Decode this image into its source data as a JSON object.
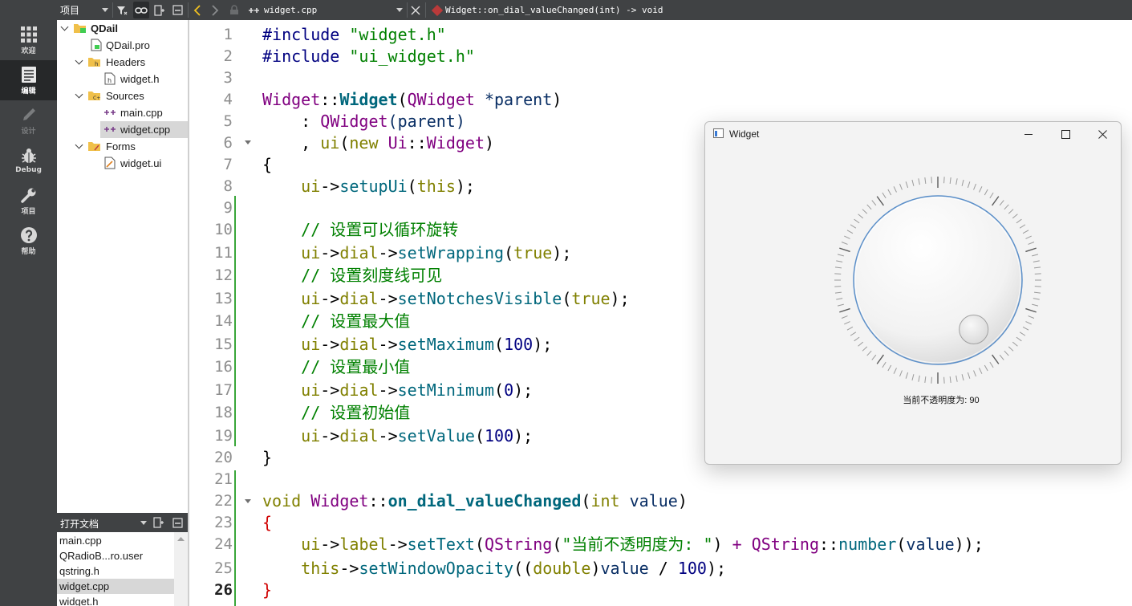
{
  "toolbar": {
    "project_selector": "项目",
    "file_tab": "widget.cpp",
    "function_path": "Widget::on_dial_valueChanged(int) -> void"
  },
  "modes": [
    {
      "label": "欢迎",
      "icon": "grid-icon"
    },
    {
      "label": "编辑",
      "icon": "document-icon"
    },
    {
      "label": "设计",
      "icon": "pencil-icon"
    },
    {
      "label": "Debug",
      "icon": "bug-icon"
    },
    {
      "label": "项目",
      "icon": "wrench-icon"
    },
    {
      "label": "帮助",
      "icon": "help-icon"
    }
  ],
  "tree": {
    "project": "QDail",
    "pro_file": "QDail.pro",
    "headers": "Headers",
    "header_file": "widget.h",
    "sources": "Sources",
    "source_main": "main.cpp",
    "source_widget": "widget.cpp",
    "forms": "Forms",
    "form_file": "widget.ui"
  },
  "open_documents": {
    "title": "打开文档",
    "items": [
      "main.cpp",
      "QRadioB...ro.user",
      "qstring.h",
      "widget.cpp",
      "widget.h"
    ]
  },
  "editor": {
    "line_numbers": [
      "1",
      "2",
      "3",
      "4",
      "5",
      "6",
      "7",
      "8",
      "9",
      "10",
      "11",
      "12",
      "13",
      "14",
      "15",
      "16",
      "17",
      "18",
      "19",
      "20",
      "21",
      "22",
      "23",
      "24",
      "25",
      "26"
    ],
    "current_line": "26",
    "code": {
      "inc": "#include",
      "inc1_file": "\"widget.h\"",
      "inc2_file": "\"ui_widget.h\"",
      "l4_class": "Widget",
      "l4_scope": "::",
      "l4_ctor": "Widget",
      "l4_open": "(",
      "l4_type": "QWidget",
      "l4_param": " *parent",
      "l4_close": ")",
      "l5_pre": "    : ",
      "l5_type": "QWidget",
      "l5_arg": "(parent)",
      "l6_pre": "    , ",
      "l6_ui": "ui",
      "l6_open": "(",
      "l6_new": "new",
      "l6_ns": "Ui",
      "l6_scope": "::",
      "l6_cls": "Widget",
      "l6_close": ")",
      "brace_open": "{",
      "brace_close": "}",
      "indent": "    ",
      "ui": "ui",
      "arrow": "->",
      "dial": "dial",
      "label": "label",
      "this": "this",
      "setupUi": "setupUi",
      "l8_args": "(",
      "l8_end": ");",
      "c10": "// 设置可以循环旋转",
      "setWrapping": "setWrapping",
      "true": "true",
      "c12": "// 设置刻度线可见",
      "setNotchesVisible": "setNotchesVisible",
      "c14": "// 设置最大值",
      "setMaximum": "setMaximum",
      "n100": "100",
      "c16": "// 设置最小值",
      "setMinimum": "setMinimum",
      "n0": "0",
      "c18": "// 设置初始值",
      "setValue": "setValue",
      "paren_open": "(",
      "end_paren": ");",
      "void": "void",
      "cls": "Widget",
      "scope": "::",
      "slot": "on_dial_valueChanged",
      "int": "int",
      "value": "value",
      "setText": "setText",
      "qstring": "QString",
      "label_str": "\"当前不透明度为: \"",
      "plus": "+",
      "number": "number",
      "setWindowOpacity": "setWindowOpacity",
      "double": "double",
      "div": "/",
      "close_paren": ")",
      "end_paren2": "));"
    }
  },
  "widget_window": {
    "title": "Widget",
    "label_text": "当前不透明度为: 90",
    "dial": {
      "min": 0,
      "max": 100,
      "value": 90,
      "wrapping": true,
      "notches_visible": true
    }
  }
}
